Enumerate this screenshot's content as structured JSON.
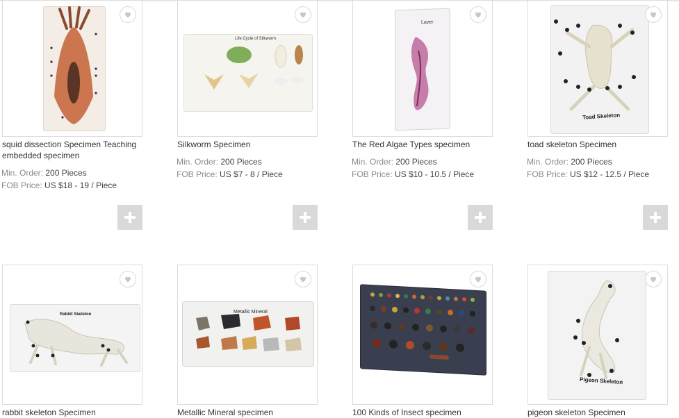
{
  "products": [
    {
      "title": "squid dissection Specimen Teaching embedded specimen",
      "min_order_label": "Min. Order:",
      "min_order": "200 Pieces",
      "fob_label": "FOB Price:",
      "fob_price": "US $18 - 19 / Piece"
    },
    {
      "title": "Silkworm Specimen",
      "min_order_label": "Min. Order:",
      "min_order": "200 Pieces",
      "fob_label": "FOB Price:",
      "fob_price": "US $7 - 8 / Piece"
    },
    {
      "title": "The Red Algae Types specimen",
      "min_order_label": "Min. Order:",
      "min_order": "200 Pieces",
      "fob_label": "FOB Price:",
      "fob_price": "US $10 - 10.5 / Piece"
    },
    {
      "title": "toad skeleton Specimen",
      "min_order_label": "Min. Order:",
      "min_order": "200 Pieces",
      "fob_label": "FOB Price:",
      "fob_price": "US $12 - 12.5 / Piece"
    },
    {
      "title": "rabbit skeleton Specimen"
    },
    {
      "title": "Metallic Mineral specimen"
    },
    {
      "title": "100 Kinds of Insect specimen"
    },
    {
      "title": "pigeon skeleton Specimen"
    }
  ],
  "image_labels": {
    "silkworm": "Life Cycle of Silkworm",
    "laver": "Laver",
    "toad": "Toad Skeleton",
    "rabbit": "Rabbit Skeleton",
    "mineral": "Metallic Mineral",
    "pigeon": "Pigeon Skeleton"
  },
  "icons": {
    "favorite": "heart-icon",
    "add": "plus-icon"
  }
}
